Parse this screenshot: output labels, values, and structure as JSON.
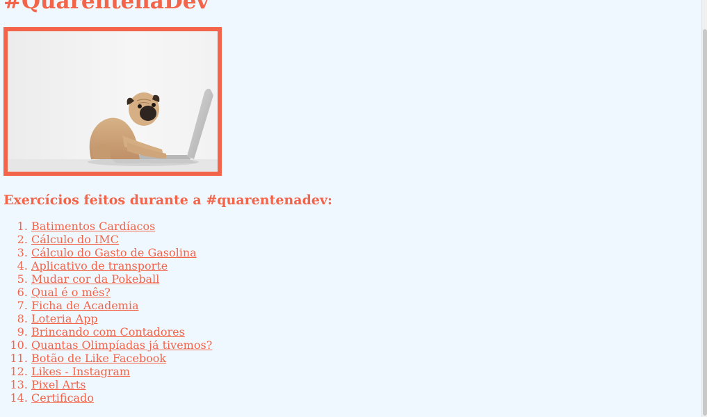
{
  "header": {
    "title": "#QuarentenaDev"
  },
  "hero": {
    "image_subject": "pug-typing-on-laptop-photo",
    "border_color": "#f2654a"
  },
  "exercises": {
    "heading": "Exercícios feitos durante a #quarentenadev:",
    "items": [
      {
        "label": "Batimentos Cardíacos"
      },
      {
        "label": "Cálculo do IMC"
      },
      {
        "label": "Cálculo do Gasto de Gasolina"
      },
      {
        "label": "Aplicativo de transporte"
      },
      {
        "label": "Mudar cor da Pokeball"
      },
      {
        "label": "Qual é o mês?"
      },
      {
        "label": "Ficha de Academia"
      },
      {
        "label": "Loteria App"
      },
      {
        "label": "Brincando com Contadores"
      },
      {
        "label": "Quantas Olimpíadas já tivemos?"
      },
      {
        "label": "Botão de Like Facebook"
      },
      {
        "label": "Likes - Instagram"
      },
      {
        "label": "Pixel Arts"
      },
      {
        "label": "Certificado"
      }
    ]
  },
  "colors": {
    "accent": "#f2654a",
    "background": "#f0f8ff"
  }
}
